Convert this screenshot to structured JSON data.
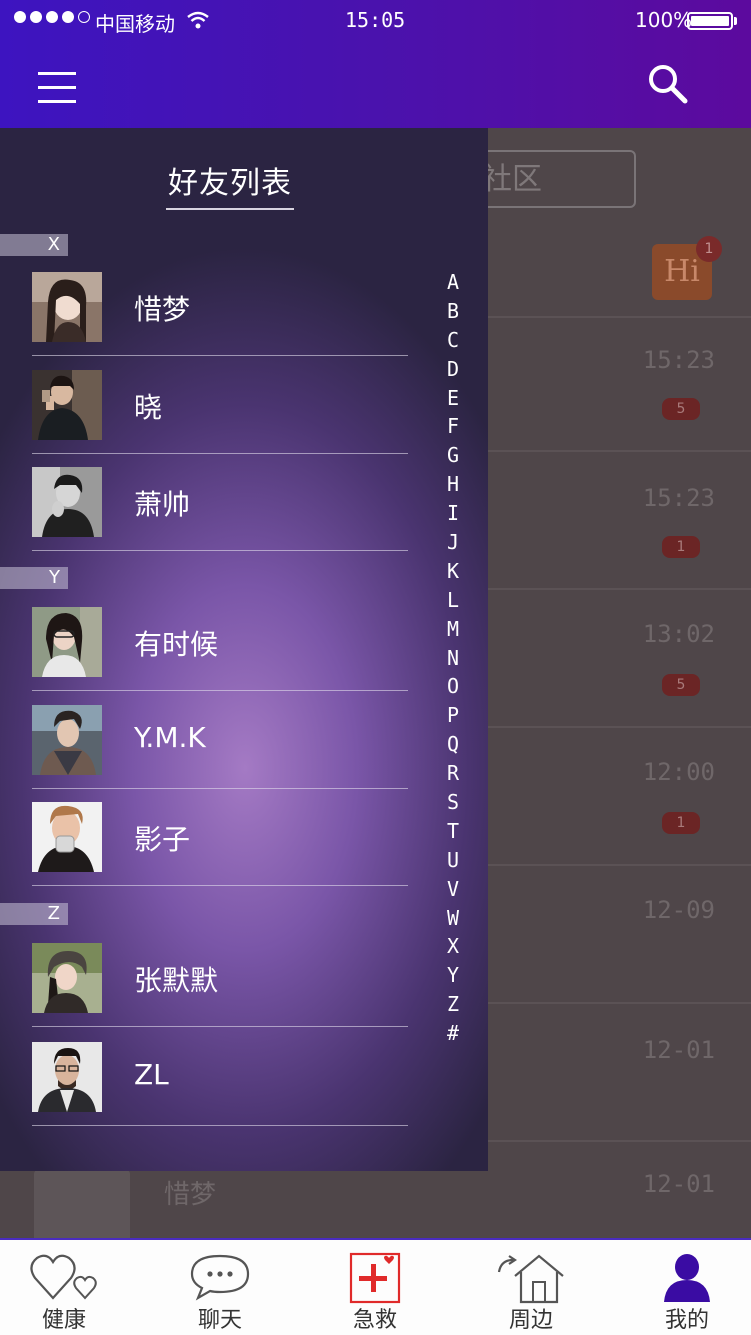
{
  "status_bar": {
    "carrier": "中国移动",
    "time": "15:05",
    "battery": "100%"
  },
  "background_page": {
    "search_partial_text": "社区",
    "hi_badge_text": "Hi",
    "hi_badge_count": "1",
    "rows": [
      {
        "time": "15:23",
        "badge": "5"
      },
      {
        "time": "15:23",
        "badge": "1"
      },
      {
        "time": "13:02",
        "badge": "5"
      },
      {
        "time": "12:00",
        "badge": "1"
      },
      {
        "time": "12-09",
        "badge": ""
      },
      {
        "time": "12-01",
        "badge": ""
      },
      {
        "time": "12-01",
        "badge": "",
        "name": "惜梦"
      }
    ]
  },
  "drawer": {
    "title": "好友列表",
    "sections": [
      {
        "letter": "X",
        "friends": [
          {
            "name": "惜梦"
          },
          {
            "name": "晓"
          },
          {
            "name": "萧帅"
          }
        ]
      },
      {
        "letter": "Y",
        "friends": [
          {
            "name": "有时候"
          },
          {
            "name": "Y.M.K"
          },
          {
            "name": "影子"
          }
        ]
      },
      {
        "letter": "Z",
        "friends": [
          {
            "name": "张默默"
          },
          {
            "name": "ZL"
          }
        ]
      }
    ],
    "alphabet_index": [
      "A",
      "B",
      "C",
      "D",
      "E",
      "F",
      "G",
      "H",
      "I",
      "J",
      "K",
      "L",
      "M",
      "N",
      "O",
      "P",
      "Q",
      "R",
      "S",
      "T",
      "U",
      "V",
      "W",
      "X",
      "Y",
      "Z",
      "#"
    ]
  },
  "tabbar": {
    "items": [
      {
        "label": "健康",
        "icon": "heart-icon"
      },
      {
        "label": "聊天",
        "icon": "chat-bubble-icon"
      },
      {
        "label": "急救",
        "icon": "first-aid-icon"
      },
      {
        "label": "周边",
        "icon": "house-icon"
      },
      {
        "label": "我的",
        "icon": "person-icon"
      }
    ],
    "active_color": "#3a0ca3"
  },
  "colors": {
    "header_gradient_start": "#3d14c0",
    "header_gradient_end": "#5c0a9e",
    "drawer_accent": "#7a56a8"
  }
}
